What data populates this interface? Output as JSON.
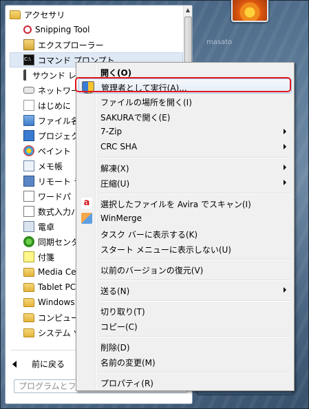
{
  "programs": [
    {
      "label": "アクセサリ",
      "icon": "folder-icon",
      "indent": false
    },
    {
      "label": "Snipping Tool",
      "icon": "snipping-tool-icon",
      "indent": true
    },
    {
      "label": "エクスプローラー",
      "icon": "explorer-icon",
      "indent": true
    },
    {
      "label": "コマンド プロンプト",
      "icon": "command-prompt-icon",
      "indent": true,
      "highlight": true
    },
    {
      "label": "サウンド レ",
      "icon": "sound-recorder-icon",
      "indent": true
    },
    {
      "label": "ネットワー",
      "icon": "network-icon",
      "indent": true
    },
    {
      "label": "はじめに",
      "icon": "getting-started-icon",
      "indent": true
    },
    {
      "label": "ファイル名",
      "icon": "run-icon",
      "indent": true
    },
    {
      "label": "プロジェク",
      "icon": "projector-icon",
      "indent": true
    },
    {
      "label": "ペイント",
      "icon": "paint-icon",
      "indent": true
    },
    {
      "label": "メモ帳",
      "icon": "notepad-icon",
      "indent": true
    },
    {
      "label": "リモート ラ",
      "icon": "remote-desktop-icon",
      "indent": true
    },
    {
      "label": "ワードパ",
      "icon": "wordpad-icon",
      "indent": true
    },
    {
      "label": "数式入力パ",
      "icon": "math-input-icon",
      "indent": true
    },
    {
      "label": "電卓",
      "icon": "calculator-icon",
      "indent": true
    },
    {
      "label": "同期センタ",
      "icon": "sync-center-icon",
      "indent": true
    },
    {
      "label": "付箋",
      "icon": "sticky-notes-icon",
      "indent": true
    },
    {
      "label": "Media Cer",
      "icon": "folder-icon",
      "indent": true
    },
    {
      "label": "Tablet PC",
      "icon": "folder-icon",
      "indent": true
    },
    {
      "label": "Windows I",
      "icon": "folder-icon",
      "indent": true
    },
    {
      "label": "コンピュー",
      "icon": "folder-icon",
      "indent": true
    },
    {
      "label": "システム ツ",
      "icon": "folder-icon",
      "indent": true
    }
  ],
  "back_label": "前に戻る",
  "search_placeholder": "プログラムとフ",
  "right_text": "masato",
  "context_menu": {
    "items": [
      {
        "label": "開く(O)",
        "bold": true
      },
      {
        "label": "管理者として実行(A)...",
        "icon": "uac-shield-icon",
        "hover": true
      },
      {
        "label": "ファイルの場所を開く(I)"
      },
      {
        "label": "SAKURAで開く(E)"
      },
      {
        "label": "7-Zip",
        "submenu": true
      },
      {
        "label": "CRC SHA",
        "submenu": true
      },
      {
        "label": "解凍(X)",
        "submenu": true
      },
      {
        "label": "圧縮(U)",
        "submenu": true
      },
      {
        "label": "選択したファイルを Avira でスキャン(I)",
        "icon": "avira-icon"
      },
      {
        "label": "WinMerge",
        "icon": "winmerge-icon"
      },
      {
        "label": "タスク バーに表示する(K)"
      },
      {
        "label": "スタート メニューに表示しない(U)"
      },
      {
        "label": "以前のバージョンの復元(V)"
      },
      {
        "label": "送る(N)",
        "submenu": true
      },
      {
        "label": "切り取り(T)"
      },
      {
        "label": "コピー(C)"
      },
      {
        "label": "削除(D)"
      },
      {
        "label": "名前の変更(M)"
      },
      {
        "label": "プロパティ(R)"
      }
    ]
  },
  "colors": {
    "highlight_outline": "#e0161b",
    "menu_background": "#f0f0f0",
    "hover_border": "#a8c6ea"
  }
}
